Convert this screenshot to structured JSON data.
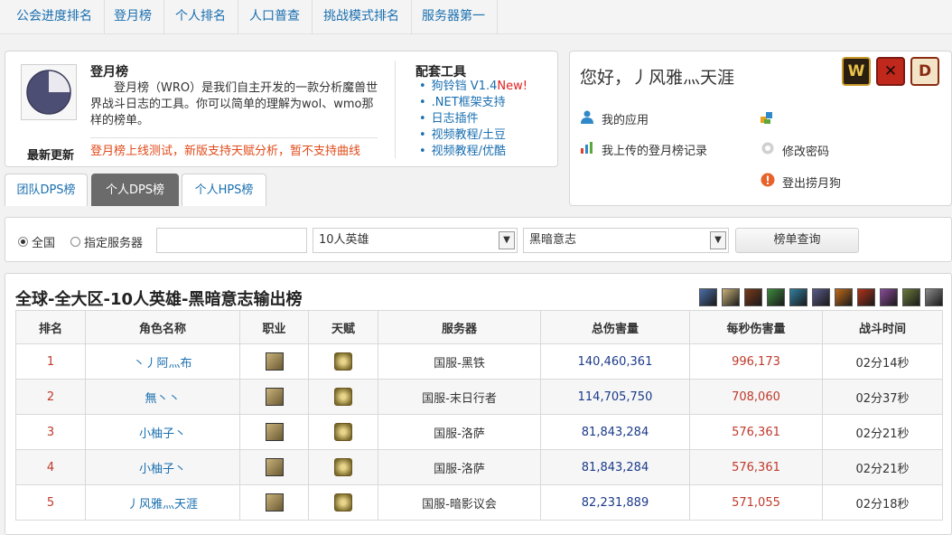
{
  "nav": {
    "items": [
      "公会进度排名",
      "登月榜",
      "个人排名",
      "人口普查",
      "挑战模式排名",
      "服务器第一"
    ]
  },
  "intro": {
    "title": "登月榜",
    "text": "登月榜（WRO）是我们自主开发的一款分析魔兽世界战斗日志的工具。你可以简单的理解为wol、wmo那样的榜单。",
    "latest_label": "最新更新",
    "latest_text": "登月榜上线测试，新版支持天赋分析，暂不支持曲线"
  },
  "tools": {
    "title": "配套工具",
    "items": [
      {
        "text": "狗铃铛 V1.4",
        "tag": "New!"
      },
      {
        "text": ".NET框架支持",
        "tag": ""
      },
      {
        "text": "日志插件",
        "tag": ""
      },
      {
        "text": "视频教程/土豆",
        "tag": ""
      },
      {
        "text": "视频教程/优酷",
        "tag": ""
      }
    ]
  },
  "user": {
    "greeting": "您好，丿风雅灬天涯",
    "links": {
      "my_apps": "我的应用",
      "my_uploads": "我上传的登月榜记录",
      "change_password": "修改密码",
      "logout": "登出捞月狗"
    },
    "game_icons": [
      {
        "name": "wow-icon",
        "label": "W",
        "color": "#c79a2b"
      },
      {
        "name": "dota-icon",
        "label": "D",
        "color": "#c0281c"
      },
      {
        "name": "diablo-icon",
        "label": "D",
        "color": "#8a2b12"
      }
    ]
  },
  "tabs": [
    {
      "label": "团队DPS榜",
      "active": false
    },
    {
      "label": "个人DPS榜",
      "active": true
    },
    {
      "label": "个人HPS榜",
      "active": false
    }
  ],
  "filter": {
    "radio_all": "全国",
    "radio_server": "指定服务器",
    "server_input": "",
    "difficulty": "10人英雄",
    "boss": "黑暗意志",
    "query_button": "榜单查询"
  },
  "ranking": {
    "title": "全球-全大区-10人英雄-黑暗意志输出榜",
    "class_filter_colors": [
      "#4a6fa8",
      "#c9b27a",
      "#7a3a1a",
      "#3e8a3e",
      "#2f7fa0",
      "#5a5a8a",
      "#c06a1a",
      "#b0321a",
      "#8a4a9a",
      "#6a7a3a",
      "#8a8a8a"
    ],
    "columns": [
      "排名",
      "角色名称",
      "职业",
      "天赋",
      "服务器",
      "总伤害量",
      "每秒伤害量",
      "战斗时间"
    ],
    "rows": [
      {
        "rank": "1",
        "name": "丶丿阿灬布",
        "server": "国服-黑铁",
        "total": "140,460,361",
        "dps": "996,173",
        "time": "02分14秒"
      },
      {
        "rank": "2",
        "name": "無丶丶",
        "server": "国服-末日行者",
        "total": "114,705,750",
        "dps": "708,060",
        "time": "02分37秒"
      },
      {
        "rank": "3",
        "name": "小柚子丶",
        "server": "国服-洛萨",
        "total": "81,843,284",
        "dps": "576,361",
        "time": "02分21秒"
      },
      {
        "rank": "4",
        "name": "小柚子丶",
        "server": "国服-洛萨",
        "total": "81,843,284",
        "dps": "576,361",
        "time": "02分21秒"
      },
      {
        "rank": "5",
        "name": "丿风雅灬天涯",
        "server": "国服-暗影议会",
        "total": "82,231,889",
        "dps": "571,055",
        "time": "02分18秒"
      }
    ]
  }
}
